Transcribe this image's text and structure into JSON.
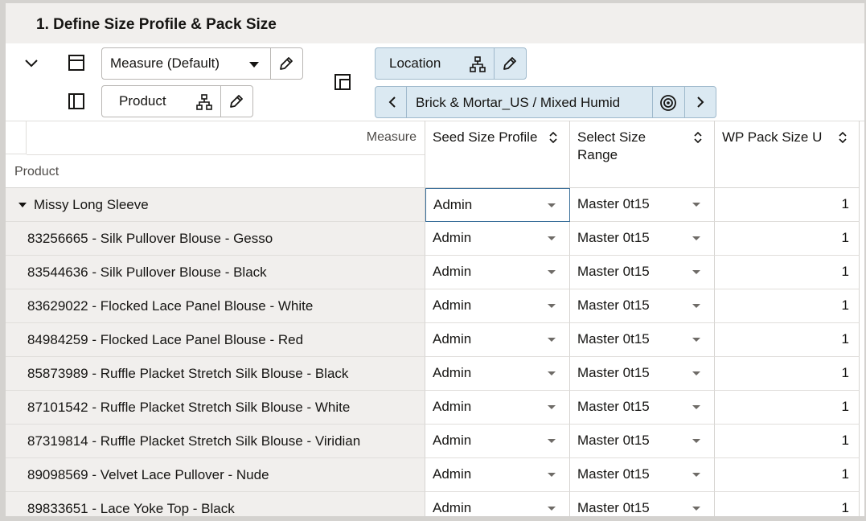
{
  "title": "1. Define Size Profile & Pack Size",
  "toolbar": {
    "measure_tile": "Measure (Default)",
    "product_tile": "Product",
    "location_tile": "Location",
    "page_selector": "Brick & Mortar_US / Mixed Humid",
    "icons": [
      "chevron-down-icon",
      "row-layout-icon",
      "column-layout-icon",
      "layout-panel-icon",
      "hierarchy-icon",
      "pencil-icon",
      "dropdown-icon",
      "chevron-left-icon",
      "chevron-right-icon",
      "target-icon"
    ]
  },
  "grid": {
    "measure_label": "Measure",
    "product_label": "Product",
    "columns": [
      {
        "label": "Seed Size Profile"
      },
      {
        "label": "Select Size Range"
      },
      {
        "label": "WP Pack Size U"
      }
    ],
    "rows": [
      {
        "name": "Missy Long Sleeve",
        "group": true,
        "seed": "Admin",
        "range": "Master 0t15",
        "pack": "1"
      },
      {
        "name": "83256665 - Silk Pullover Blouse - Gesso",
        "seed": "Admin",
        "range": "Master 0t15",
        "pack": "1"
      },
      {
        "name": "83544636 - Silk Pullover Blouse - Black",
        "seed": "Admin",
        "range": "Master 0t15",
        "pack": "1"
      },
      {
        "name": "83629022 - Flocked Lace Panel Blouse - White",
        "seed": "Admin",
        "range": "Master 0t15",
        "pack": "1"
      },
      {
        "name": "84984259 - Flocked Lace Panel Blouse - Red",
        "seed": "Admin",
        "range": "Master 0t15",
        "pack": "1"
      },
      {
        "name": "85873989 - Ruffle Placket Stretch Silk Blouse - Black",
        "seed": "Admin",
        "range": "Master 0t15",
        "pack": "1"
      },
      {
        "name": "87101542 - Ruffle Placket Stretch Silk Blouse - White",
        "seed": "Admin",
        "range": "Master 0t15",
        "pack": "1"
      },
      {
        "name": "87319814 - Ruffle Placket Stretch Silk Blouse - Viridian",
        "seed": "Admin",
        "range": "Master 0t15",
        "pack": "1"
      },
      {
        "name": "89098569 - Velvet Lace Pullover - Nude",
        "seed": "Admin",
        "range": "Master 0t15",
        "pack": "1"
      },
      {
        "name": "89833651 - Lace Yoke Top - Black",
        "seed": "Admin",
        "range": "Master 0t15",
        "pack": "1"
      }
    ]
  }
}
